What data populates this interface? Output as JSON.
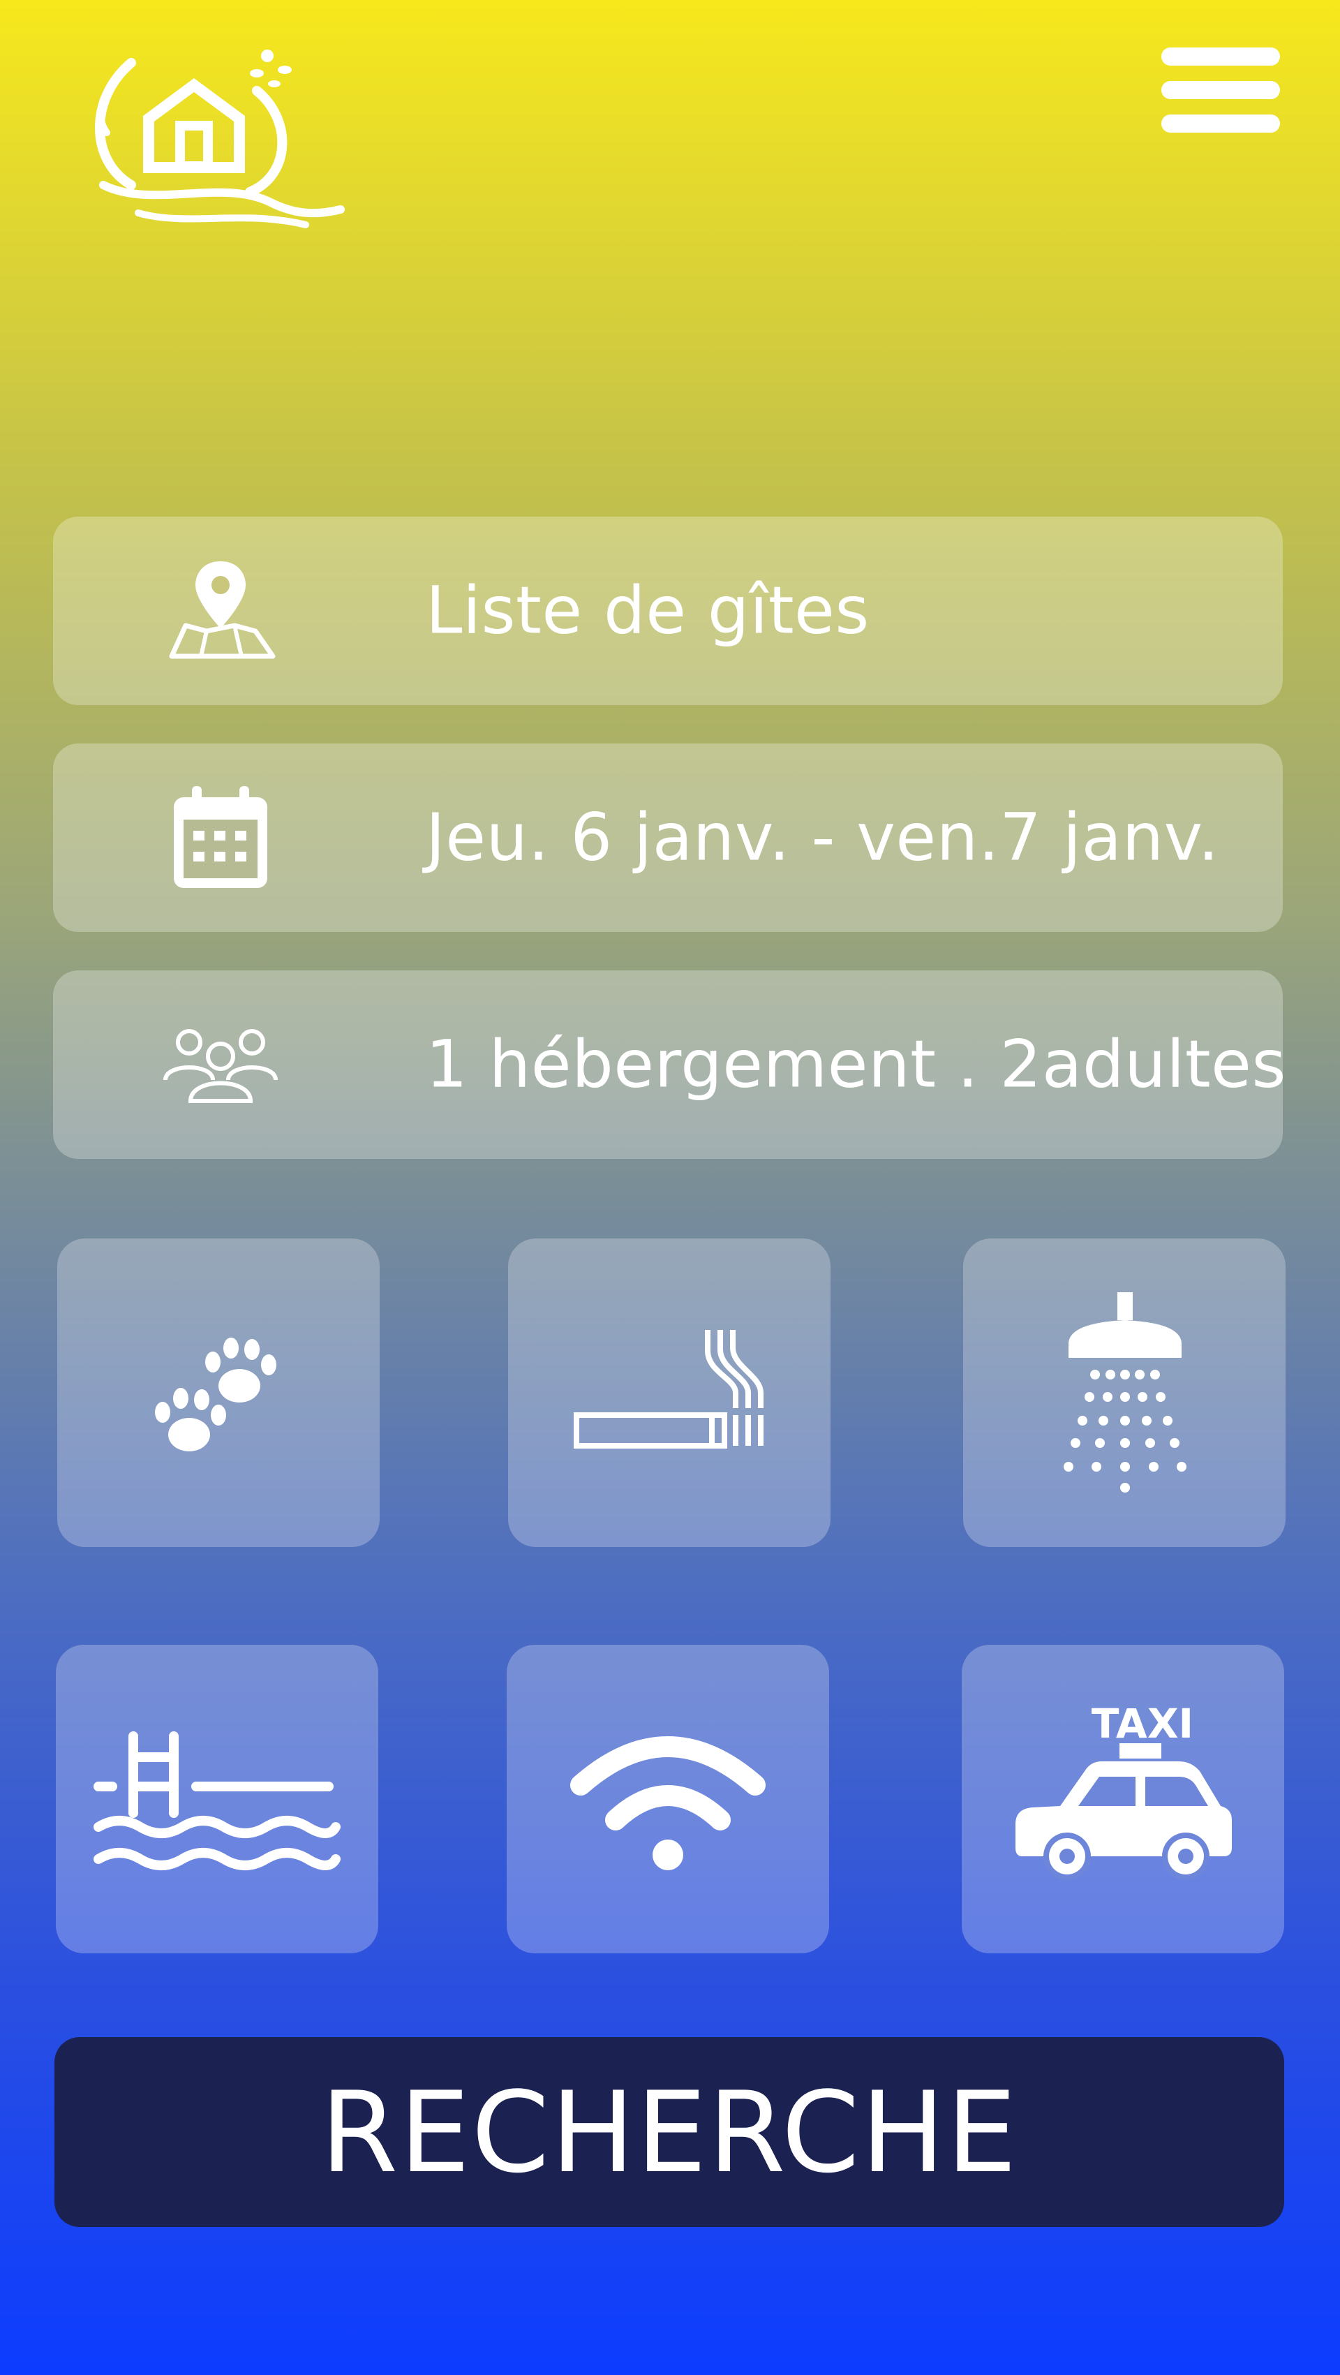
{
  "header": {
    "logo_icon": "gite-house-logo-icon",
    "menu_icon": "hamburger-menu-icon"
  },
  "fields": [
    {
      "icon": "map-pin-icon",
      "label": "Liste de gîtes"
    },
    {
      "icon": "calendar-icon",
      "label": "Jeu. 6 janv. - ven.7 janv."
    },
    {
      "icon": "group-people-icon",
      "label": "1 hébergement . 2adultes"
    }
  ],
  "amenities": [
    {
      "icon": "paw-prints-icon",
      "name": "pets"
    },
    {
      "icon": "smoking-icon",
      "name": "smoking"
    },
    {
      "icon": "shower-icon",
      "name": "shower"
    },
    {
      "icon": "pool-ladder-icon",
      "name": "pool"
    },
    {
      "icon": "wifi-icon",
      "name": "wifi"
    },
    {
      "icon": "taxi-icon",
      "name": "taxi",
      "text": "TAXI"
    }
  ],
  "search_button": {
    "label": "RECHERCHE"
  },
  "colors": {
    "gradient_top": "#f7e81c",
    "gradient_bottom": "#0c3cff",
    "button_bg": "#1b2150"
  }
}
